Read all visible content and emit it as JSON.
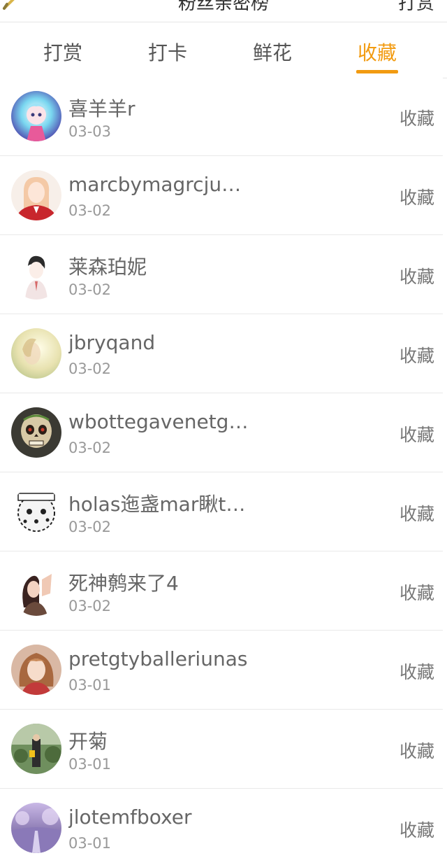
{
  "header": {
    "title": "粉丝亲密榜",
    "right_label": "打赏"
  },
  "tabs": [
    {
      "label": "打赏"
    },
    {
      "label": "打卡"
    },
    {
      "label": "鲜花"
    },
    {
      "label": "收藏"
    }
  ],
  "active_tab_color": "#f29b11",
  "items": [
    {
      "name": "喜羊羊r",
      "date": "03-03",
      "action": "收藏"
    },
    {
      "name": "marcbymagrcju…",
      "date": "03-02",
      "action": "收藏"
    },
    {
      "name": "莱森珀妮",
      "date": "03-02",
      "action": "收藏"
    },
    {
      "name": "jbryqand",
      "date": "03-02",
      "action": "收藏"
    },
    {
      "name": "wbottegavenetg…",
      "date": "03-02",
      "action": "收藏"
    },
    {
      "name": "holas迤盏mar瞅t…",
      "date": "03-02",
      "action": "收藏"
    },
    {
      "name": "死神鹩来了4",
      "date": "03-02",
      "action": "收藏"
    },
    {
      "name": "pretgtyballeriunas",
      "date": "03-01",
      "action": "收藏"
    },
    {
      "name": "开菊",
      "date": "03-01",
      "action": "收藏"
    },
    {
      "name": "jlotemfboxer",
      "date": "03-01",
      "action": "收藏"
    }
  ]
}
